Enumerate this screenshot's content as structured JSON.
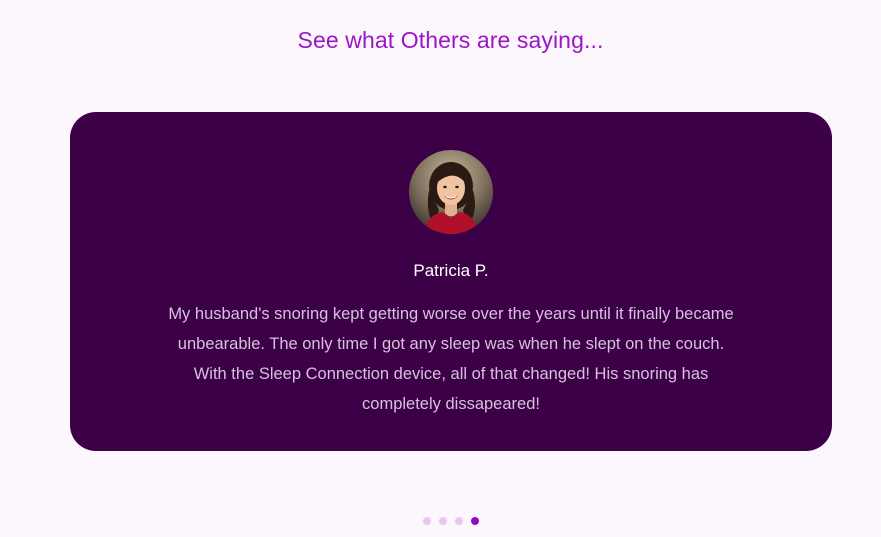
{
  "section": {
    "heading": "See what Others are saying..."
  },
  "testimonial": {
    "name": "Patricia P.",
    "quote": "My husband's snoring kept getting worse over the years until it finally became unbearable. The only time I got any sleep was when he slept on the couch. With the Sleep Connection device, all of that changed! His snoring has completely dissapeared!",
    "avatar_icon": "woman-portrait-photo"
  },
  "carousel": {
    "total_slides": 4,
    "active_index": 3
  },
  "colors": {
    "heading": "#9b16c4",
    "card_background": "#3c0046",
    "dot_inactive": "#e7c6ef",
    "dot_active": "#8c0fbf"
  }
}
